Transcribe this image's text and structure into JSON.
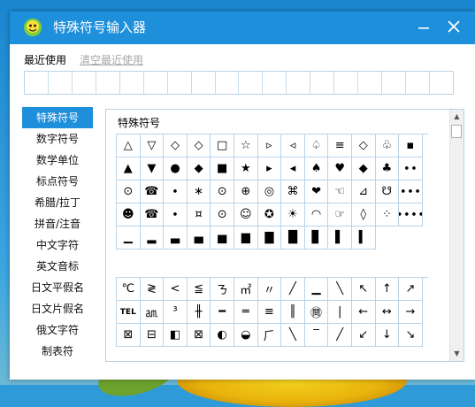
{
  "window": {
    "title": "特殊符号输入器"
  },
  "recent": {
    "label": "最近使用",
    "clear_label": "清空最近使用",
    "cells": 18
  },
  "categories": [
    {
      "label": "特殊符号",
      "active": true
    },
    {
      "label": "数字符号"
    },
    {
      "label": "数学单位"
    },
    {
      "label": "标点符号"
    },
    {
      "label": "希腊/拉丁"
    },
    {
      "label": "拼音/注音"
    },
    {
      "label": "中文字符"
    },
    {
      "label": "英文音标"
    },
    {
      "label": "日文平假名"
    },
    {
      "label": "日文片假名"
    },
    {
      "label": "俄文字符"
    },
    {
      "label": "制表符"
    }
  ],
  "panel": {
    "title": "特殊符号",
    "group1": [
      [
        "△",
        "▽",
        "◇",
        "◇",
        "□",
        "☆",
        "▹",
        "◃",
        "♤",
        "≡",
        "◇",
        "♧",
        "▪"
      ],
      [
        "▲",
        "▼",
        "●",
        "◆",
        "■",
        "★",
        "▸",
        "◂",
        "♠",
        "♥",
        "◆",
        "♣",
        "∙∙"
      ],
      [
        "⊙",
        "☎",
        "∙",
        "∗",
        "⊙",
        "⊕",
        "◎",
        "⌘",
        "❤",
        "☜",
        "⊿",
        "☋",
        "∙∙∙"
      ],
      [
        "☻",
        "☎",
        "∙",
        "¤",
        "⊙",
        "☺",
        "✪",
        "☀",
        "◠",
        "☞",
        "◊",
        "⁘",
        "∙∙∙∙∙∙"
      ],
      [
        "▁",
        "▂",
        "▃",
        "▄",
        "▅",
        "▆",
        "▇",
        "█",
        "▊",
        "▌",
        "▍"
      ]
    ],
    "group2": [
      [
        "℃",
        "≷",
        "<",
        "≦",
        "ㄋ",
        "㎡",
        "〃",
        "╱",
        "▁",
        "╲",
        "↖",
        "↑",
        "↗"
      ],
      [
        "TEL",
        "㏂",
        "³",
        "╫",
        "━",
        "═",
        "≡",
        "║",
        "㉄",
        "|",
        "←",
        "↔",
        "→"
      ],
      [
        "⊠",
        "⊟",
        "◧",
        "⊠",
        "◐",
        "◒",
        "⺁",
        "╲",
        "‾",
        "╱",
        "↙",
        "↓",
        "↘"
      ]
    ]
  }
}
